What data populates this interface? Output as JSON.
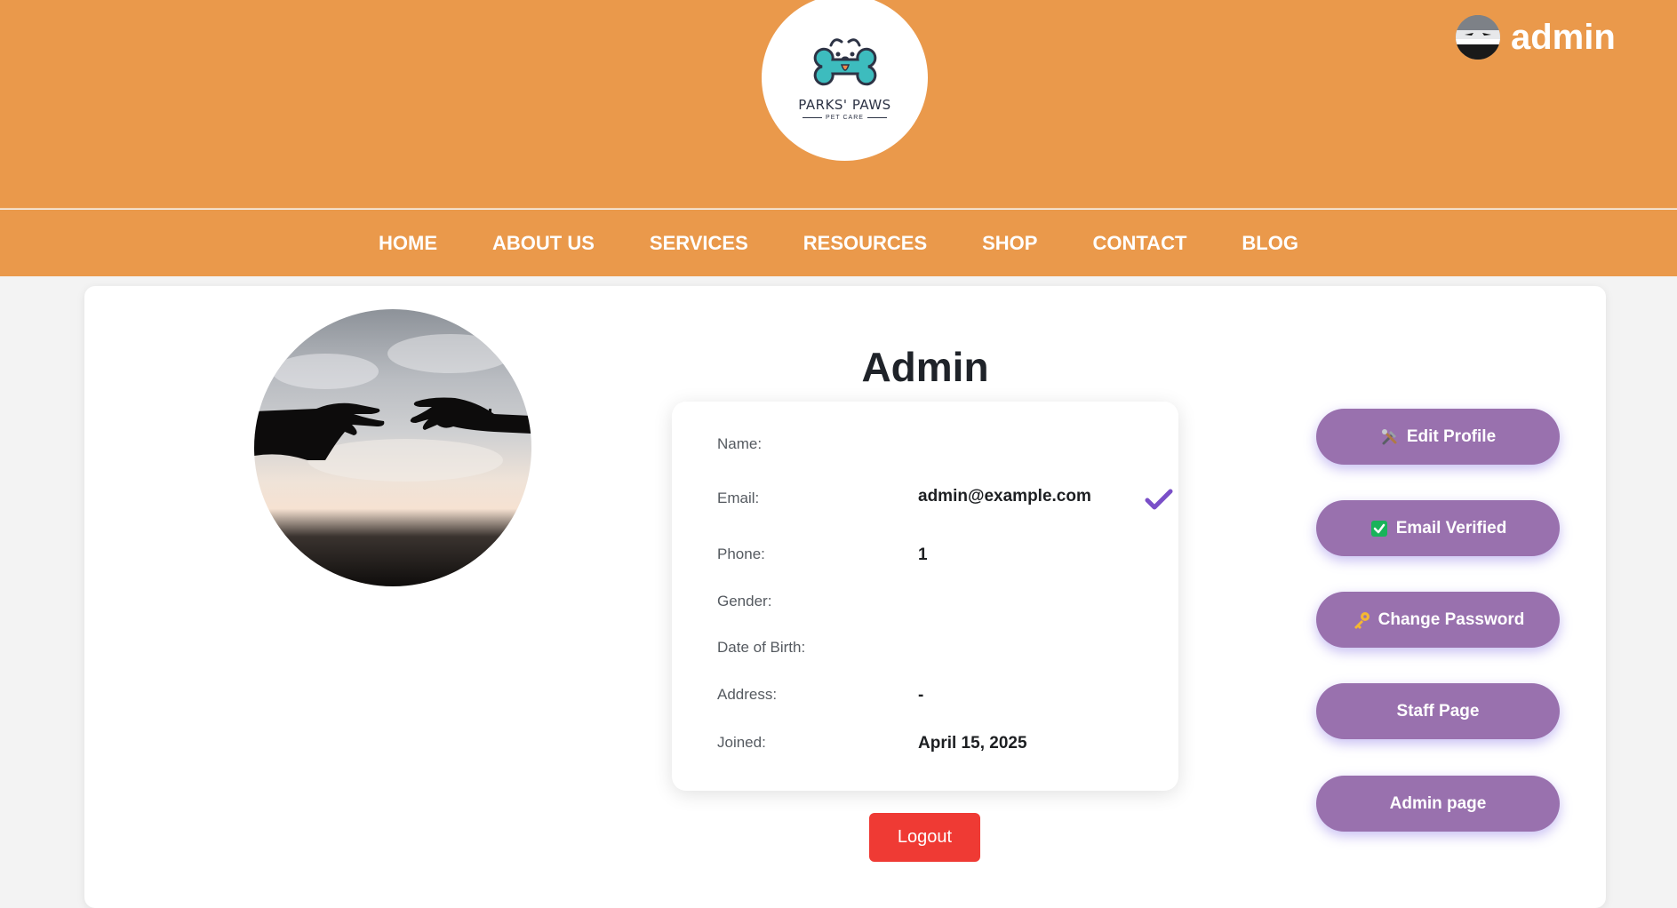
{
  "brand": {
    "name": "PARKS' PAWS",
    "tagline": "PET CARE"
  },
  "user": {
    "username": "admin"
  },
  "nav": {
    "items": [
      {
        "label": "HOME"
      },
      {
        "label": "ABOUT US"
      },
      {
        "label": "SERVICES"
      },
      {
        "label": "RESOURCES"
      },
      {
        "label": "SHOP"
      },
      {
        "label": "CONTACT"
      },
      {
        "label": "BLOG"
      }
    ]
  },
  "profile": {
    "title": "Admin",
    "fields": {
      "name": {
        "label": "Name:",
        "value": ""
      },
      "email": {
        "label": "Email:",
        "value": "admin@example.com"
      },
      "phone": {
        "label": "Phone:",
        "value": "1"
      },
      "gender": {
        "label": "Gender:",
        "value": ""
      },
      "dob": {
        "label": "Date of Birth:",
        "value": ""
      },
      "address": {
        "label": "Address:",
        "value": "-"
      },
      "joined": {
        "label": "Joined:",
        "value": "April 15, 2025"
      }
    }
  },
  "actions": {
    "edit_profile": "Edit Profile",
    "email_verified": "Email Verified",
    "change_password": "Change Password",
    "staff_page": "Staff Page",
    "admin_page": "Admin page",
    "logout": "Logout"
  },
  "icons": {
    "edit_profile": "tools-icon",
    "email_verified": "check-box-icon",
    "change_password": "key-icon",
    "email_status": "check-icon"
  },
  "colors": {
    "header": "#ea994b",
    "button": "#9971ae",
    "logout": "#ef3a34",
    "check": "#7a4fc8",
    "verified_box": "#19b35a"
  }
}
